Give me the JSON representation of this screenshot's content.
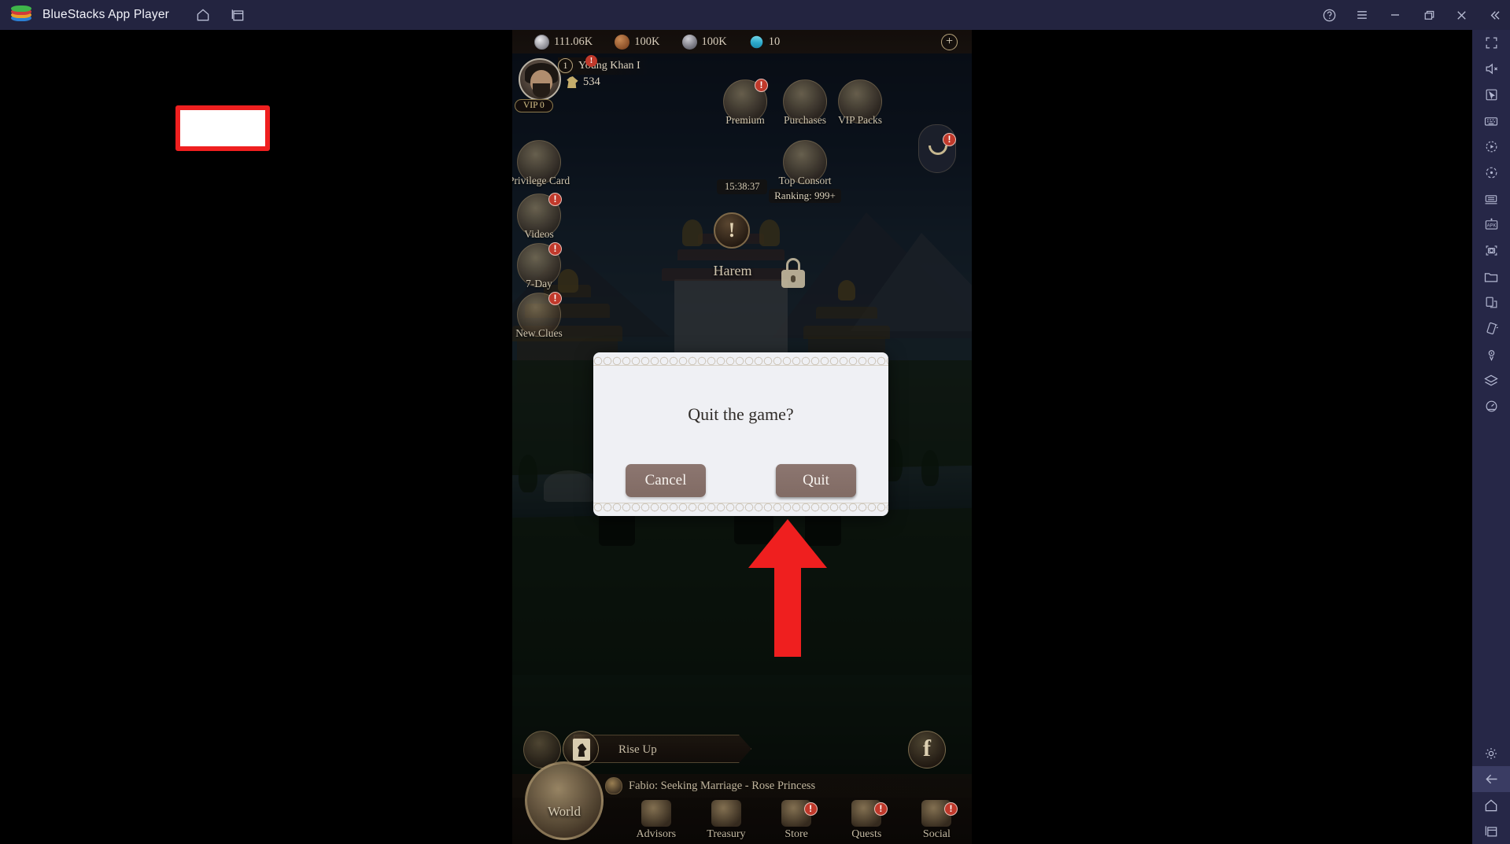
{
  "titlebar": {
    "app_title": "BlueStacks App Player",
    "left_icons": [
      {
        "name": "home-icon",
        "label": "Home"
      },
      {
        "name": "app-center-icon",
        "label": "App Center"
      }
    ],
    "right_icons": [
      {
        "name": "help-icon",
        "label": "Help"
      },
      {
        "name": "menu-icon",
        "label": "Menu"
      },
      {
        "name": "minimize-icon",
        "label": "Minimize"
      },
      {
        "name": "maximize-icon",
        "label": "Maximize"
      },
      {
        "name": "close-icon",
        "label": "Close"
      },
      {
        "name": "collapse-sidebar-icon",
        "label": "Collapse"
      }
    ]
  },
  "sidebar_right": {
    "items": [
      {
        "name": "fullscreen-icon",
        "label": "Full screen"
      },
      {
        "name": "mute-icon",
        "label": "Mute"
      },
      {
        "name": "cursor-icon",
        "label": "Cursor"
      },
      {
        "name": "keyboard-controls-icon",
        "label": "Game controls"
      },
      {
        "name": "macro-recorder-icon",
        "label": "Macro recorder"
      },
      {
        "name": "sync-operations-icon",
        "label": "Sync operations"
      },
      {
        "name": "multi-instance-icon",
        "label": "Multi-instance manager"
      },
      {
        "name": "apk-install-icon",
        "label": "Install APK"
      },
      {
        "name": "screenshot-icon",
        "label": "Screenshot"
      },
      {
        "name": "media-folder-icon",
        "label": "Media manager"
      },
      {
        "name": "copy-paste-icon",
        "label": "Copy to PC"
      },
      {
        "name": "shake-icon",
        "label": "Shake"
      },
      {
        "name": "location-icon",
        "label": "Location"
      },
      {
        "name": "layers-icon",
        "label": "Eco mode"
      },
      {
        "name": "performance-icon",
        "label": "Performance"
      }
    ],
    "bottom_items": [
      {
        "name": "settings-gear-icon",
        "label": "Settings",
        "active": false
      },
      {
        "name": "back-arrow-icon",
        "label": "Back",
        "active": true
      },
      {
        "name": "android-home-icon",
        "label": "Home",
        "active": false
      },
      {
        "name": "recent-apps-icon",
        "label": "Recent apps",
        "active": false
      }
    ]
  },
  "game": {
    "resources": [
      {
        "icon": "silver-coin-icon",
        "value": "111.06K"
      },
      {
        "icon": "food-icon",
        "value": "100K"
      },
      {
        "icon": "iron-helmet-icon",
        "value": "100K"
      },
      {
        "icon": "gem-icon",
        "value": "10"
      }
    ],
    "add_resource_label": "+",
    "player": {
      "name": "Young Khan I",
      "level": "1",
      "alert": "!",
      "power": "534",
      "vip": "VIP 0",
      "avatar_name": "player-avatar"
    },
    "left_rail": [
      {
        "name": "privilege-card-button",
        "label": "Privilege Card",
        "badge": ""
      },
      {
        "name": "videos-button",
        "label": "Videos",
        "badge": "!"
      },
      {
        "name": "seven-day-button",
        "label": "7-Day",
        "badge": "!"
      },
      {
        "name": "new-clues-button",
        "label": "New Clues",
        "badge": "!"
      }
    ],
    "right_rail": [
      {
        "name": "premium-button",
        "label": "Premium",
        "badge": "!",
        "sub": "15:38:37"
      },
      {
        "name": "purchases-button",
        "label": "Purchases",
        "badge": "",
        "sub": ""
      },
      {
        "name": "vip-packs-button",
        "label": "VIP Packs",
        "badge": "",
        "sub": ""
      },
      {
        "name": "top-consort-button",
        "label": "Top Consort",
        "badge": "",
        "sub": "Ranking: 999+"
      }
    ],
    "vip_tab_badge": "!",
    "building": {
      "name": "Harem",
      "alert": "!"
    },
    "chat": {
      "placeholder": "Rise Up",
      "facebook_label": "f"
    },
    "event_banner": "Fabio: Seeking Marriage - Rose Princess",
    "world_button": "World",
    "nav": [
      {
        "name": "nav-advisors",
        "label": "Advisors",
        "badge": ""
      },
      {
        "name": "nav-treasury",
        "label": "Treasury",
        "badge": ""
      },
      {
        "name": "nav-store",
        "label": "Store",
        "badge": "!"
      },
      {
        "name": "nav-quests",
        "label": "Quests",
        "badge": "!"
      },
      {
        "name": "nav-social",
        "label": "Social",
        "badge": "!"
      }
    ]
  },
  "dialog": {
    "title": "Quit the game?",
    "cancel_label": "Cancel",
    "quit_label": "Quit"
  },
  "annotation": {
    "highlight_color": "#ef1f1f",
    "arrow_name": "pointing-arrow",
    "target": "quit-button"
  }
}
